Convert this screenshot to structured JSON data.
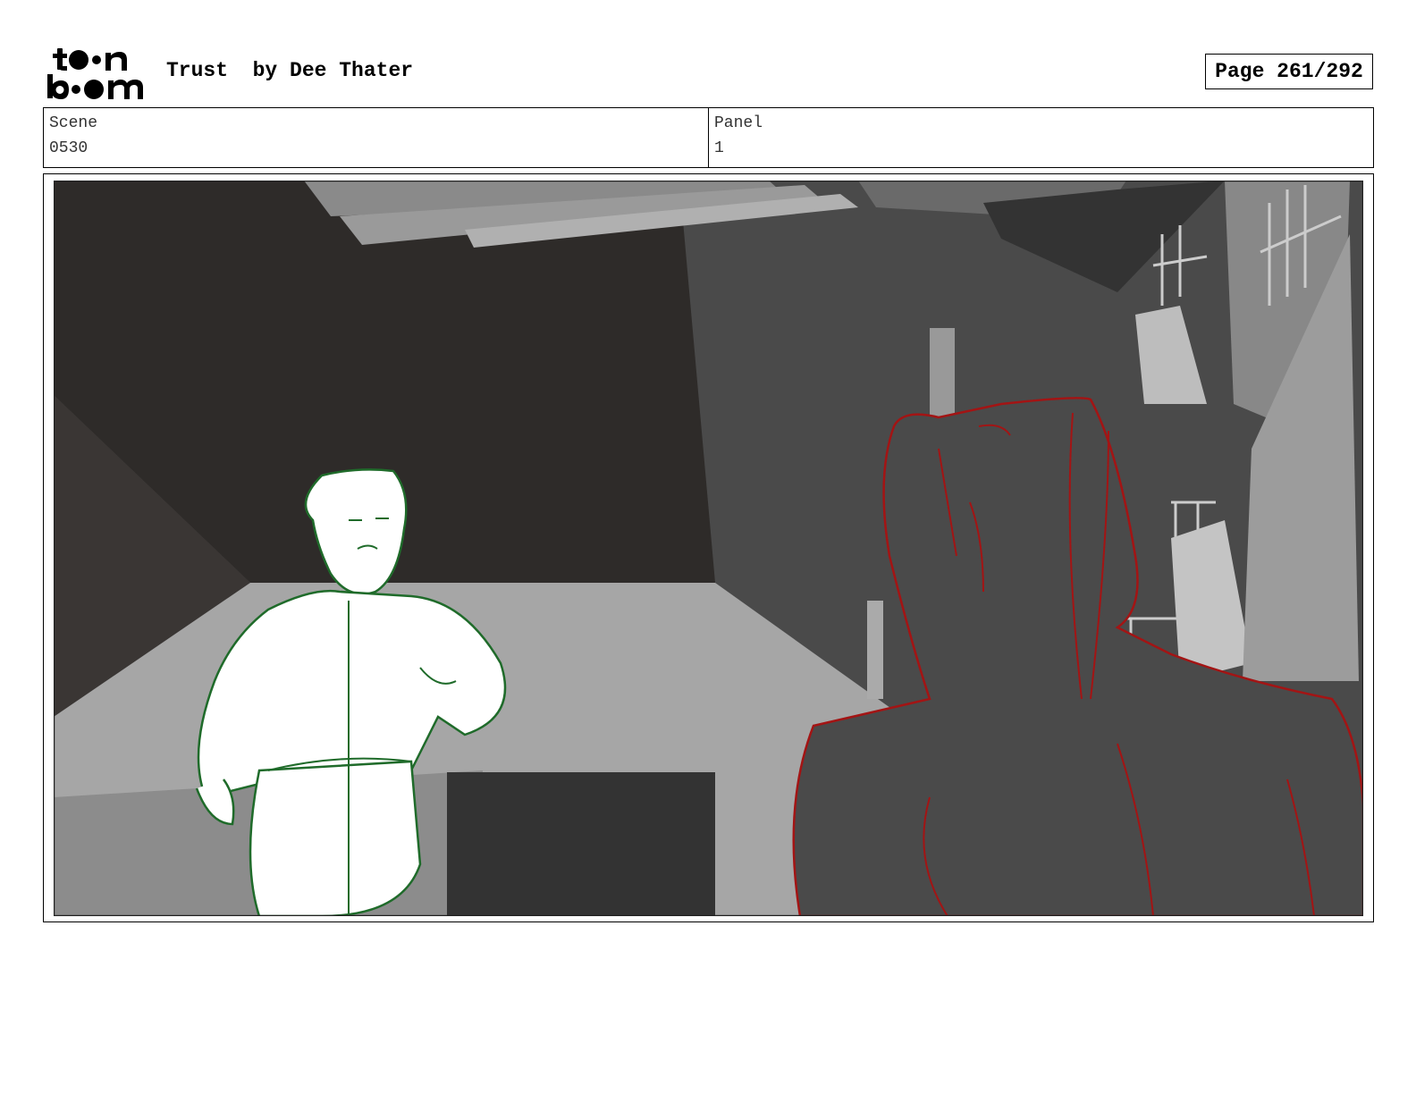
{
  "header": {
    "logo": {
      "line1": "toon",
      "line2": "boom",
      "icon": "toon-boom-logo"
    },
    "title": "Trust  by Dee Thater",
    "page_indicator": "Page 261/292"
  },
  "info": {
    "scene_label": "Scene",
    "scene_value": "0530",
    "panel_label": "Panel",
    "panel_value": "1"
  },
  "panel": {
    "image": "storyboard-panel-image",
    "colors": {
      "character_left_line": "#1f6b2a",
      "character_right_line": "#a31414",
      "background_dark": "#2e2b29",
      "background_mid": "#4a4a4a",
      "floor": "#a6a6a6"
    }
  }
}
